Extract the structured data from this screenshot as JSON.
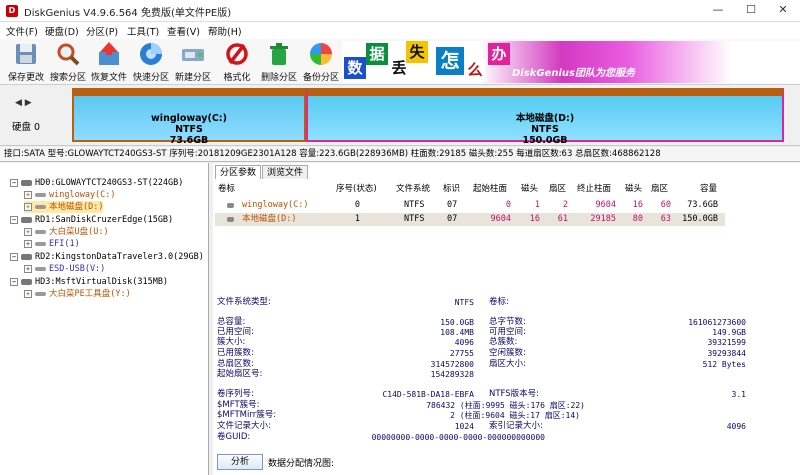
{
  "window": {
    "title": "DiskGenius V4.9.6.564 免费版(单文件PE版)",
    "controls": [
      "—",
      "☐",
      "✕"
    ]
  },
  "menu": [
    "文件(F)",
    "硬盘(D)",
    "分区(P)",
    "工具(T)",
    "查看(V)",
    "帮助(H)"
  ],
  "toolbar": [
    {
      "label": "保存更改",
      "icon": "save-icon"
    },
    {
      "label": "搜索分区",
      "icon": "search-icon"
    },
    {
      "label": "恢复文件",
      "icon": "recover-icon"
    },
    {
      "label": "快速分区",
      "icon": "quick-partition-icon"
    },
    {
      "label": "新建分区",
      "icon": "new-partition-icon"
    },
    {
      "label": "格式化",
      "icon": "format-icon"
    },
    {
      "label": "删除分区",
      "icon": "delete-icon"
    },
    {
      "label": "备份分区",
      "icon": "backup-icon"
    }
  ],
  "banner": {
    "chars": [
      "数",
      "据",
      "丢",
      "失",
      "怎",
      "么",
      "办"
    ],
    "brand": "DiskGenius团队为您服务"
  },
  "disk_map": {
    "nav": "◀ ▶",
    "disk_label": "硬盘 0",
    "partitions": [
      {
        "name": "wingloway(C:)",
        "fs": "NTFS",
        "size": "73.6GB"
      },
      {
        "name": "本地磁盘(D:)",
        "fs": "NTFS",
        "size": "150.0GB"
      }
    ]
  },
  "info_bar": "接口:SATA  型号:GLOWAYTCT240GS3-ST  序列号:20181209GE2301A128  容量:223.6GB(228936MB)  柱面数:29185  磁头数:255  每道扇区数:63  总扇区数:468862128",
  "tree": [
    {
      "text": "HD0:GLOWAYTCT240GS3-ST(224GB)",
      "level": 0,
      "color": "#000"
    },
    {
      "text": "wingloway(C:)",
      "level": 1,
      "color": "#c05000"
    },
    {
      "text": "本地磁盘(D:)",
      "level": 1,
      "color": "#c05000"
    },
    {
      "text": "RD1:SanDiskCruzerEdge(15GB)",
      "level": 0,
      "color": "#000"
    },
    {
      "text": "大白菜U盘(U:)",
      "level": 1,
      "color": "#c05000"
    },
    {
      "text": "EFI(1)",
      "level": 1,
      "color": "#3030c0"
    },
    {
      "text": "RD2:KingstonDataTraveler3.0(29GB)",
      "level": 0,
      "color": "#000"
    },
    {
      "text": "ESD-USB(V:)",
      "level": 1,
      "color": "#3030c0"
    },
    {
      "text": "HD3:MsftVirtualDisk(315MB)",
      "level": 0,
      "color": "#000"
    },
    {
      "text": "大白菜PE工具盘(Y:)",
      "level": 1,
      "color": "#c05000"
    }
  ],
  "tabs": [
    "分区参数",
    "浏览文件"
  ],
  "partition_table": {
    "headers": [
      "卷标",
      "序号(状态)",
      "文件系统",
      "标识",
      "起始柱面",
      "磁头",
      "扇区",
      "终止柱面",
      "磁头",
      "扇区",
      "容量"
    ],
    "rows": [
      [
        "wingloway(C:)",
        "0",
        "NTFS",
        "07",
        "0",
        "1",
        "2",
        "9604",
        "16",
        "60",
        "73.6GB"
      ],
      [
        "本地磁盘(D:)",
        "1",
        "NTFS",
        "07",
        "9604",
        "16",
        "61",
        "29185",
        "80",
        "63",
        "150.0GB"
      ]
    ]
  },
  "details": {
    "fs_type_label": "文件系统类型:",
    "fs_type_value": "NTFS",
    "vol_label_label": "卷标:",
    "left_block": [
      [
        "总容量:",
        "150.0GB"
      ],
      [
        "已用空间:",
        "108.4MB"
      ],
      [
        "簇大小:",
        "4096"
      ],
      [
        "已用簇数:",
        "27755"
      ],
      [
        "总扇区数:",
        "314572800"
      ],
      [
        "起始扇区号:",
        "154289328"
      ]
    ],
    "right_block": [
      [
        "总字节数:",
        "161061273600"
      ],
      [
        "可用空间:",
        "149.9GB"
      ],
      [
        "总簇数:",
        "39321599"
      ],
      [
        "空闲簇数:",
        "39293844"
      ],
      [
        "扇区大小:",
        "512 Bytes"
      ]
    ],
    "left_block2": [
      [
        "卷序列号:",
        "C14D-581B-DA18-EBFA"
      ],
      [
        "$MFT簇号:",
        "786432 (柱面:9995 磁头:176 扇区:22)"
      ],
      [
        "$MFTMirr簇号:",
        "2 (柱面:9604 磁头:17 扇区:14)"
      ],
      [
        "文件记录大小:",
        "1024"
      ],
      [
        "卷GUID:",
        "00000000-0000-0000-0000-000000000000"
      ]
    ],
    "right_block2": [
      [
        "NTFS版本号:",
        "3.1"
      ],
      [
        "索引记录大小:",
        "4096"
      ]
    ]
  },
  "analyze": {
    "button": "分析",
    "note": "数据分配情况图:"
  },
  "colors": {
    "partition_c": "#5bc8f0",
    "partition_d": "#55ccf2",
    "partition_border": "#b85f10",
    "accent_pink": "#e0239a"
  }
}
